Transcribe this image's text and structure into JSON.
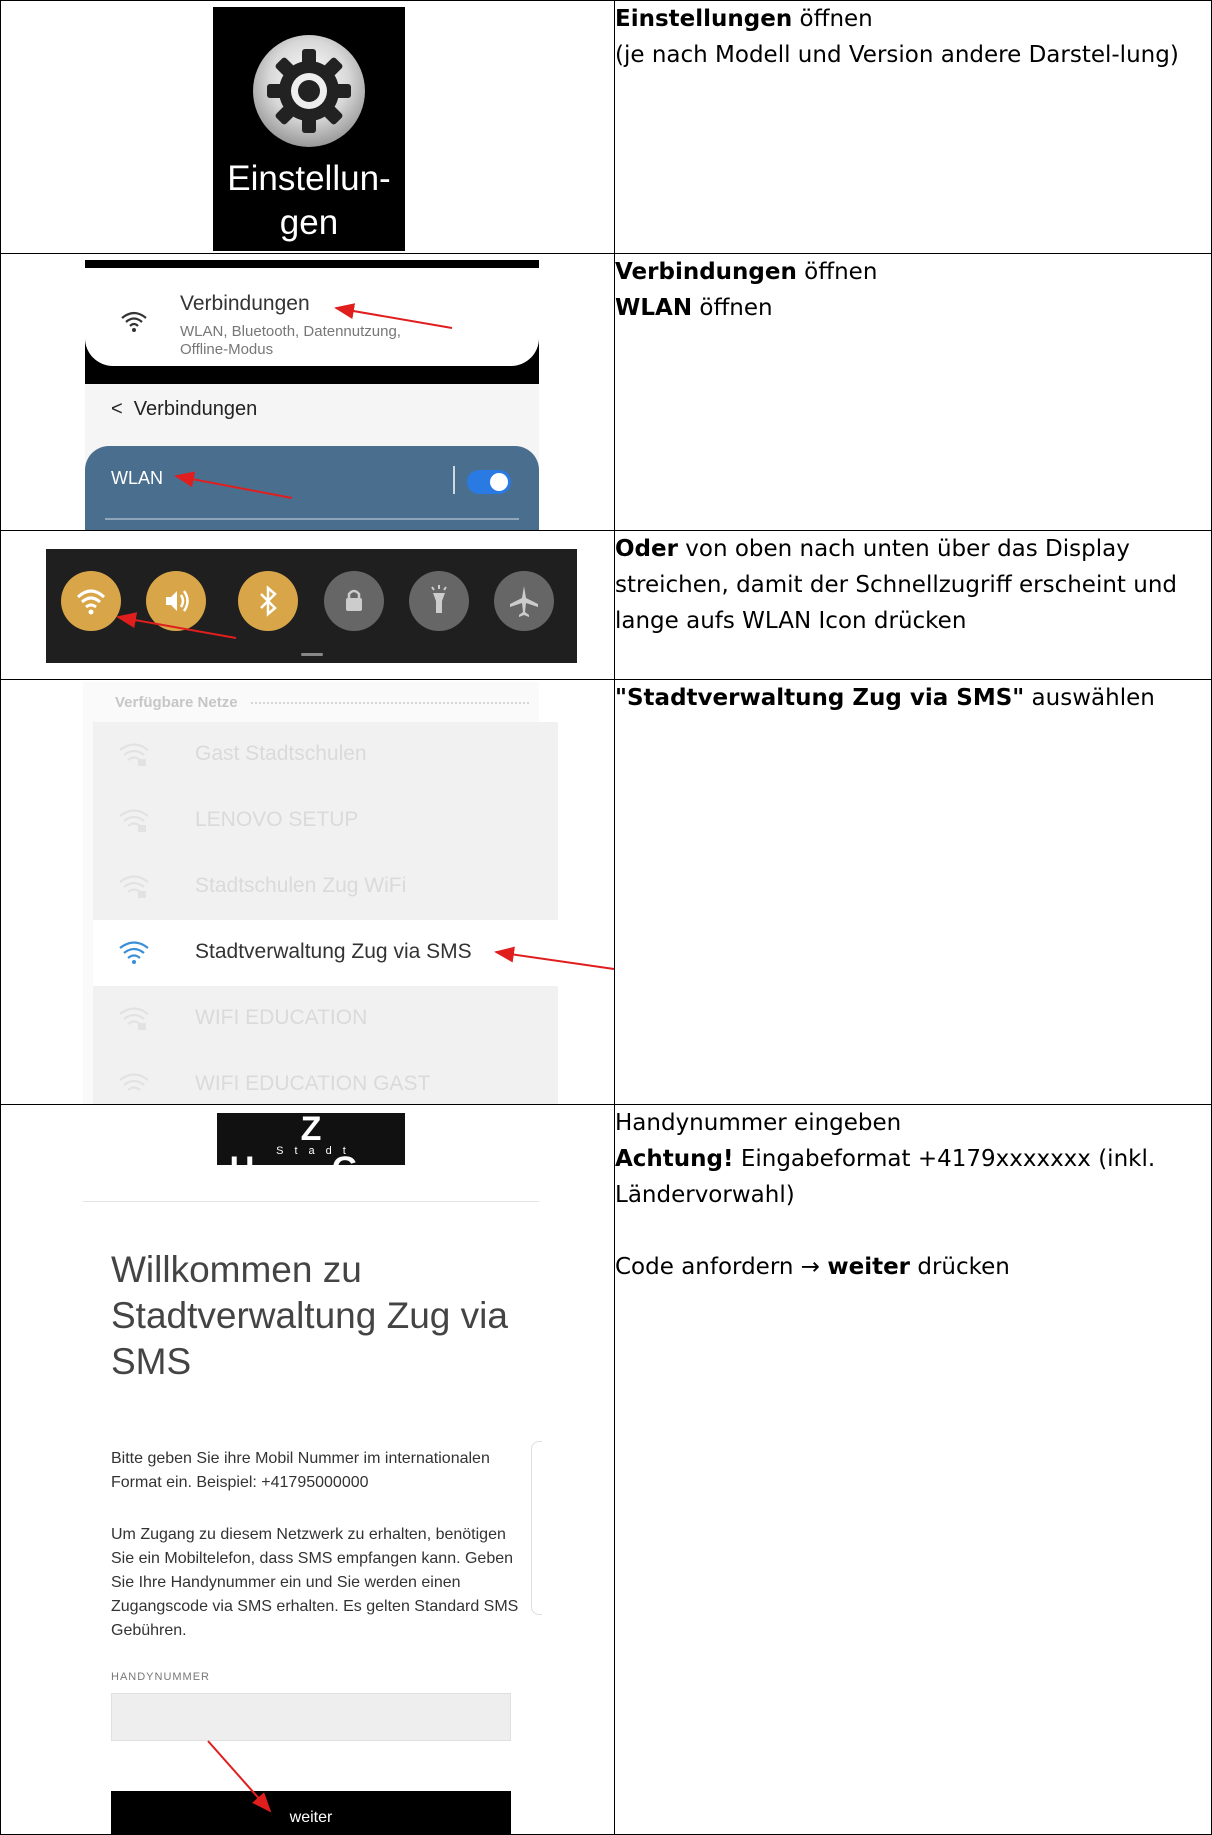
{
  "rows": [
    {
      "screenshot": {
        "label_line1": "Einstellun-",
        "label_line2": "gen"
      },
      "text": {
        "p1_bold": "Einstellungen",
        "p1_rest": " öffnen",
        "p2": "(je nach Modell und Version andere Darstel-lung)"
      }
    },
    {
      "screenshot": {
        "title": "Verbindungen",
        "subtitle": "WLAN, Bluetooth, Datennutzung, Offline-Modus",
        "back_title": "Verbindungen",
        "wlan_label": "WLAN"
      },
      "text": {
        "p1_bold": "Verbindungen",
        "p1_rest": " öffnen",
        "p2_bold": "WLAN",
        "p2_rest": " öffnen"
      }
    },
    {
      "screenshot": {
        "icons": [
          "wifi-icon",
          "volume-icon",
          "bluetooth-icon",
          "lock-icon",
          "flashlight-icon",
          "airplane-icon"
        ]
      },
      "text": {
        "p1_bold": "Oder",
        "p1_rest": " von oben nach unten über das Display streichen, damit der Schnellzugriff erscheint und lange aufs WLAN Icon drücken"
      }
    },
    {
      "screenshot": {
        "header": "Verfügbare Netze",
        "networks": [
          "Gast Stadtschulen",
          "LENOVO SETUP",
          "Stadtschulen Zug WiFi",
          "Stadtverwaltung Zug via SMS",
          "WIFI EDUCATION",
          "WIFI EDUCATION GAST"
        ],
        "selected_index": 3
      },
      "text": {
        "p1_bold": "\"Stadtverwaltung Zug via SMS\"",
        "p1_rest": " auswählen"
      }
    },
    {
      "screenshot": {
        "logo_big": "Z U G",
        "logo_small": "Stadt",
        "welcome": "Willkommen zu Stadtverwaltung Zug via SMS",
        "para1": "Bitte geben Sie ihre Mobil Nummer im internationalen Format ein. Beispiel: +41795000000",
        "para2": "Um Zugang zu diesem Netzwerk zu erhalten, benötigen Sie ein Mobiltelefon, dass SMS empfangen kann. Geben Sie Ihre Handynummer ein und Sie werden einen Zugangscode via SMS erhalten. Es gelten Standard SMS Gebühren.",
        "field_label": "HANDYNUMMER",
        "field_value": "",
        "button": "weiter"
      },
      "text": {
        "p1": "Handynummer eingeben",
        "p2_bold": "Achtung!",
        "p2_rest": " Eingabeformat +4179xxxxxxx (inkl. Ländervorwahl)",
        "p3_pre": "Code anfordern → ",
        "p3_bold": "weiter",
        "p3_rest": " drücken"
      }
    }
  ],
  "colors": {
    "arrow": "#e01e1e",
    "quick_on": "#d8a548",
    "wlan_bar": "#4a6f8e",
    "toggle": "#2a7ae4"
  }
}
